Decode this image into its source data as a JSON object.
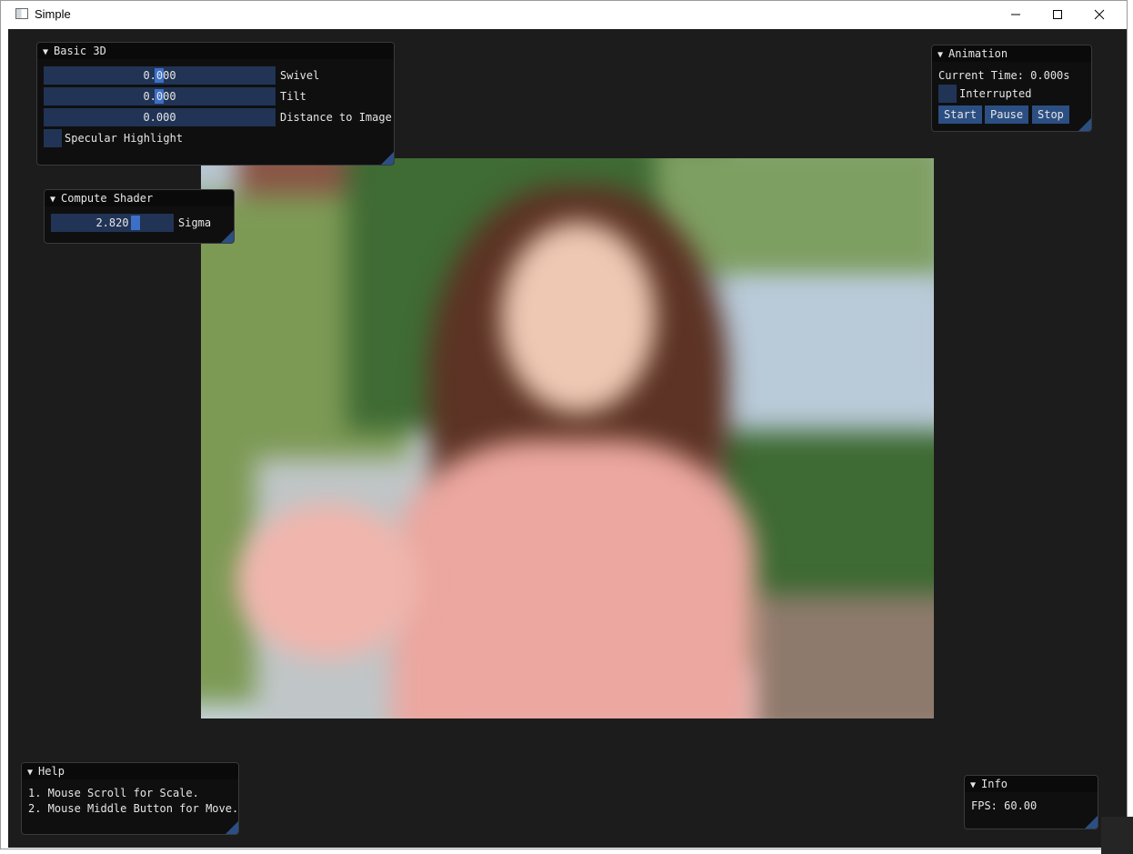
{
  "window": {
    "title": "Simple"
  },
  "panels": {
    "basic3d": {
      "title": "Basic 3D",
      "sliders": [
        {
          "value": "0.000",
          "label": "Swivel"
        },
        {
          "value": "0.000",
          "label": "Tilt"
        },
        {
          "value": "0.000",
          "label": "Distance to Image"
        }
      ],
      "checkbox_label": "Specular Highlight"
    },
    "compute": {
      "title": "Compute Shader",
      "slider": {
        "value": "2.820",
        "label": "Sigma"
      }
    },
    "animation": {
      "title": "Animation",
      "current_time": "Current Time: 0.000s",
      "checkbox_label": "Interrupted",
      "buttons": [
        "Start",
        "Pause",
        "Stop"
      ]
    },
    "help": {
      "title": "Help",
      "lines": [
        "1. Mouse Scroll for Scale.",
        "2. Mouse Middle Button for Move."
      ]
    },
    "info": {
      "title": "Info",
      "fps": "FPS: 60.00"
    }
  },
  "colors": {
    "background": "#1c1c1c",
    "panel_bg": "#0f0f0f",
    "frame_bg": "#213456",
    "button": "#2c4f83",
    "grab": "#3d6fc8"
  },
  "icons": [
    "app-icon",
    "minimize-icon",
    "maximize-icon",
    "close-icon",
    "collapse-arrow-icon",
    "resize-grip-icon"
  ]
}
